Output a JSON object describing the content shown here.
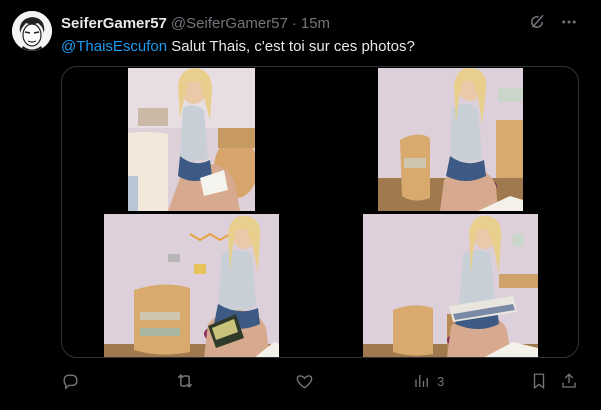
{
  "tweet": {
    "display_name": "SeiferGamer57",
    "handle": "@SeiferGamer57",
    "separator": "·",
    "time": "15m",
    "mention": "@ThaisEscufon",
    "text": " Salut Thais, c'est toi sur ces photos?"
  },
  "media": {
    "photos": [
      {
        "description_icon": "photo"
      },
      {
        "description_icon": "photo"
      },
      {
        "description_icon": "photo"
      },
      {
        "description_icon": "photo"
      }
    ]
  },
  "actions": {
    "views_count": "3"
  },
  "icons": {
    "top": [
      "grok-icon",
      "more-icon"
    ],
    "actions": [
      "reply-icon",
      "retweet-icon",
      "like-icon",
      "views-icon",
      "bookmark-icon",
      "share-icon"
    ]
  },
  "colors": {
    "background": "#000000",
    "text": "#e7e9ea",
    "secondary": "#71767b",
    "link": "#1d9bf0",
    "border": "#2f3336"
  }
}
